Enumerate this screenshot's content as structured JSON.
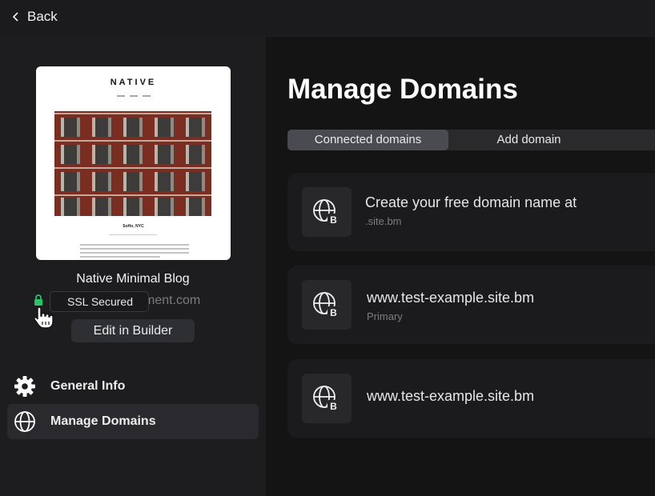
{
  "header": {
    "back_label": "Back"
  },
  "site": {
    "preview_logo": "NATIVE",
    "preview_caption": "SoHo, NYC",
    "name": "Native Minimal Blog",
    "domain_partial": "ment.com",
    "ssl_tooltip": "SSL Secured",
    "edit_label": "Edit in Builder"
  },
  "sidebar": {
    "items": [
      {
        "label": "General Info",
        "icon": "gear-icon",
        "active": false
      },
      {
        "label": "Manage Domains",
        "icon": "globe-icon",
        "active": true
      }
    ]
  },
  "main": {
    "title": "Manage Domains",
    "tabs": [
      {
        "label": "Connected domains",
        "active": true
      },
      {
        "label": "Add domain",
        "active": false
      }
    ],
    "domains": [
      {
        "title": "Create your free domain name at",
        "sub": ".site.bm"
      },
      {
        "title": "www.test-example.site.bm",
        "sub": "Primary"
      },
      {
        "title": "www.test-example.site.bm",
        "sub": ""
      }
    ]
  },
  "colors": {
    "lock": "#27c46a",
    "active_tab": "#4a4b51",
    "card_bg": "#1b1b1d"
  }
}
